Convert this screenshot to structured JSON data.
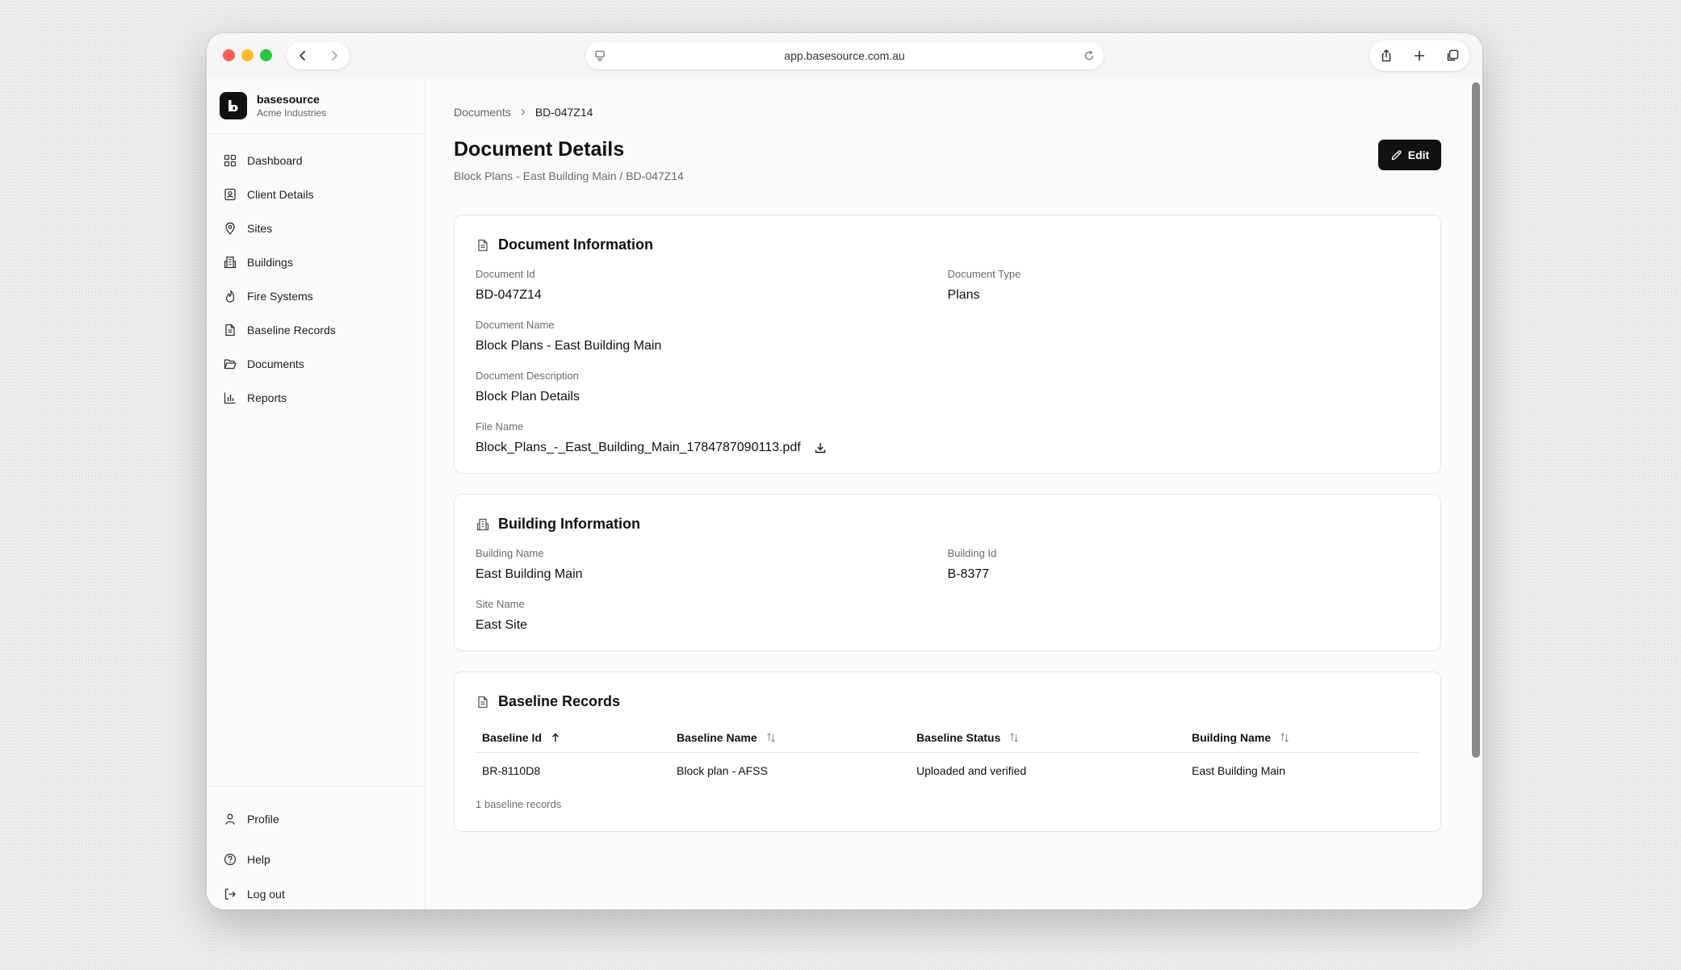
{
  "browser": {
    "url": "app.basesource.com.au"
  },
  "brand": {
    "name": "basesource",
    "org": "Acme Industries"
  },
  "sidebar": {
    "items": [
      {
        "label": "Dashboard",
        "icon": "dashboard-grid-icon"
      },
      {
        "label": "Client Details",
        "icon": "contact-card-icon"
      },
      {
        "label": "Sites",
        "icon": "map-pin-icon"
      },
      {
        "label": "Buildings",
        "icon": "building-icon"
      },
      {
        "label": "Fire Systems",
        "icon": "flame-icon"
      },
      {
        "label": "Baseline Records",
        "icon": "file-text-icon"
      },
      {
        "label": "Documents",
        "icon": "folder-open-icon"
      },
      {
        "label": "Reports",
        "icon": "bar-chart-icon"
      }
    ],
    "bottom": [
      {
        "label": "Profile",
        "icon": "user-icon"
      },
      {
        "label": "Help",
        "icon": "help-circle-icon"
      },
      {
        "label": "Log out",
        "icon": "log-out-icon"
      }
    ]
  },
  "breadcrumb": {
    "parent": "Documents",
    "current": "BD-047Z14"
  },
  "page": {
    "title": "Document Details",
    "subtitle": "Block Plans - East Building Main / BD-047Z14",
    "edit_label": "Edit"
  },
  "document_info": {
    "title": "Document Information",
    "fields": {
      "id": {
        "label": "Document Id",
        "value": "BD-047Z14"
      },
      "type": {
        "label": "Document Type",
        "value": "Plans"
      },
      "name": {
        "label": "Document Name",
        "value": "Block Plans - East Building Main"
      },
      "description": {
        "label": "Document Description",
        "value": "Block Plan Details"
      },
      "file": {
        "label": "File Name",
        "value": "Block_Plans_-_East_Building_Main_1784787090113.pdf"
      }
    }
  },
  "building_info": {
    "title": "Building Information",
    "fields": {
      "name": {
        "label": "Building Name",
        "value": "East Building Main"
      },
      "id": {
        "label": "Building Id",
        "value": "B-8377"
      },
      "site": {
        "label": "Site Name",
        "value": "East Site"
      }
    }
  },
  "baseline_records": {
    "title": "Baseline Records",
    "columns": [
      "Baseline Id",
      "Baseline Name",
      "Baseline Status",
      "Building Name"
    ],
    "rows": [
      [
        "BR-8110D8",
        "Block plan - AFSS",
        "Uploaded and verified",
        "East Building Main"
      ]
    ],
    "count_text": "1 baseline records"
  },
  "colors": {
    "primary_button": "#111111",
    "close": "#ff5f57",
    "minimize": "#febc2e",
    "zoom": "#28c840"
  }
}
